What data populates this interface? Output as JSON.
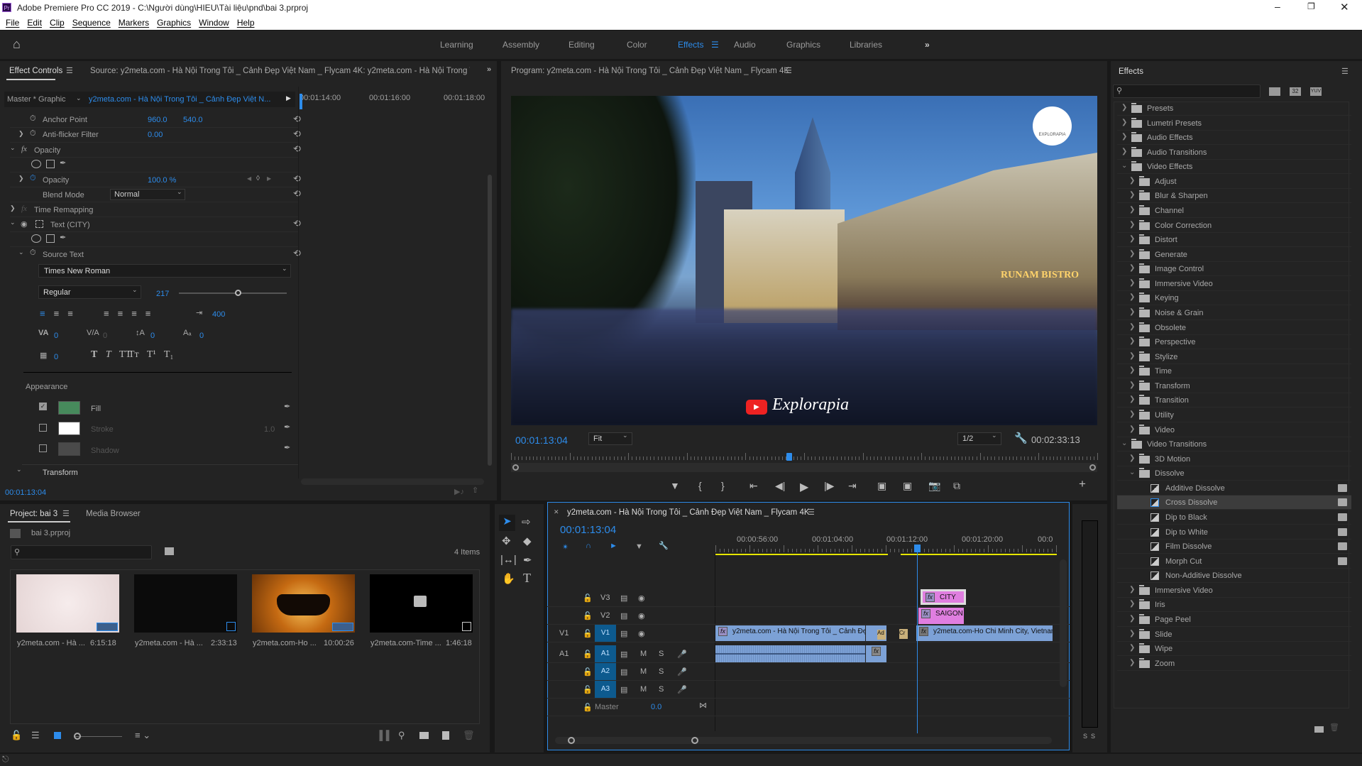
{
  "window": {
    "title": "Adobe Premiere Pro CC 2019 - C:\\Người dùng\\HIEU\\Tài liệu\\pnd\\bai 3.prproj",
    "app_icon": "Pr"
  },
  "menu": [
    "File",
    "Edit",
    "Clip",
    "Sequence",
    "Markers",
    "Graphics",
    "Window",
    "Help"
  ],
  "workspaces": {
    "items": [
      "Learning",
      "Assembly",
      "Editing",
      "Color",
      "Effects",
      "Audio",
      "Graphics",
      "Libraries"
    ],
    "active": "Effects"
  },
  "effect_controls": {
    "tab": "Effect Controls",
    "source_tab": "Source: y2meta.com - Hà Nội Trong Tôi _ Cảnh Đẹp Việt Nam _ Flycam 4K: y2meta.com - Hà Nội Trong Tôi _",
    "master": "Master * Graphic",
    "clip": "y2meta.com - Hà Nội Trong Tôi _ Cảnh Đẹp Việt N...",
    "ruler": [
      "00:01:14:00",
      "00:01:16:00",
      "00:01:18:00"
    ],
    "anchor_label": "Anchor Point",
    "anchor_x": "960.0",
    "anchor_y": "540.0",
    "antiflicker_label": "Anti-flicker Filter",
    "antiflicker": "0.00",
    "opacity_group": "Opacity",
    "opacity_label": "Opacity",
    "opacity": "100.0 %",
    "blend_label": "Blend Mode",
    "blend": "Normal",
    "time_remap": "Time Remapping",
    "text_layer": "Text (CITY)",
    "source_text": "Source Text",
    "font": "Times New Roman",
    "style": "Regular",
    "size": "217",
    "size_fraction": 0.55,
    "tab_width": "400",
    "kerning": "0",
    "tracking": "0",
    "leading": "0",
    "baseline": "0",
    "tsume": "0",
    "appearance": "Appearance",
    "fill_label": "Fill",
    "fill_color": "#478a5c",
    "fill_checked": true,
    "stroke_label": "Stroke",
    "stroke_color": "#ffffff",
    "stroke_width": "1.0",
    "stroke_checked": false,
    "shadow_label": "Shadow",
    "shadow_checked": false,
    "transform": "Transform",
    "timecode": "00:01:13:04"
  },
  "program": {
    "title": "Program: y2meta.com - Hà Nội Trong Tôi _ Cảnh Đẹp Việt Nam _ Flycam 4K",
    "timecode": "00:01:13:04",
    "zoom": "Fit",
    "resolution": "1/2",
    "duration": "00:02:33:13",
    "playhead_fraction": 0.475,
    "overlay_text": "Explorapia",
    "sign_text": "RUNAM BISTRO",
    "logo_text": "EXPLORAPIA"
  },
  "project": {
    "tab": "Project: bai 3",
    "media_browser": "Media Browser",
    "file": "bai 3.prproj",
    "count": "4 Items",
    "items": [
      {
        "name": "y2meta.com - Hà ...",
        "duration": "6:15:18"
      },
      {
        "name": "y2meta.com - Hà ...",
        "duration": "2:33:13"
      },
      {
        "name": "y2meta.com-Ho ...",
        "duration": "10:00:26"
      },
      {
        "name": "y2meta.com-Time ...",
        "duration": "1:46:18"
      }
    ]
  },
  "timeline": {
    "title": "y2meta.com - Hà Nội Trong Tôi _ Cảnh Đẹp Việt Nam _ Flycam 4K",
    "timecode": "00:01:13:04",
    "ruler": [
      "00:00:56:00",
      "00:01:04:00",
      "00:01:12:00",
      "00:01:20:00",
      "00:0"
    ],
    "tracks": {
      "v3": "V3",
      "v2": "V2",
      "v1": "V1",
      "a1": "A1",
      "a2": "A2",
      "a3": "A3",
      "master": "Master",
      "master_val": "0.0",
      "m": "M",
      "s": "S"
    },
    "clips": {
      "v1a": "y2meta.com - Hà Nội Trong Tôi _ Cảnh Đẹp",
      "v1b": "y2meta.com-Ho Chi Minh City, Vietnam",
      "city": "CITY",
      "saigon": "SAIGON",
      "fx": "fx",
      "ad": "Ad",
      "cr": "Cr"
    },
    "accent": "#2d8ceb",
    "clip_video": "#7ca1d6",
    "clip_graphic": "#e07ee0"
  },
  "meter": {
    "s1": "S",
    "s2": "S"
  },
  "effects": {
    "title": "Effects",
    "badges": [
      "accelerated",
      "32",
      "YUV"
    ],
    "tree": [
      {
        "label": "Presets",
        "level": 0,
        "type": "star"
      },
      {
        "label": "Lumetri Presets",
        "level": 0,
        "type": "star"
      },
      {
        "label": "Audio Effects",
        "level": 0,
        "type": "folder"
      },
      {
        "label": "Audio Transitions",
        "level": 0,
        "type": "folder"
      },
      {
        "label": "Video Effects",
        "level": 0,
        "type": "folder",
        "open": true
      },
      {
        "label": "Adjust",
        "level": 1,
        "type": "folder"
      },
      {
        "label": "Blur & Sharpen",
        "level": 1,
        "type": "folder"
      },
      {
        "label": "Channel",
        "level": 1,
        "type": "folder"
      },
      {
        "label": "Color Correction",
        "level": 1,
        "type": "folder"
      },
      {
        "label": "Distort",
        "level": 1,
        "type": "folder"
      },
      {
        "label": "Generate",
        "level": 1,
        "type": "folder"
      },
      {
        "label": "Image Control",
        "level": 1,
        "type": "folder"
      },
      {
        "label": "Immersive Video",
        "level": 1,
        "type": "folder"
      },
      {
        "label": "Keying",
        "level": 1,
        "type": "folder"
      },
      {
        "label": "Noise & Grain",
        "level": 1,
        "type": "folder"
      },
      {
        "label": "Obsolete",
        "level": 1,
        "type": "folder"
      },
      {
        "label": "Perspective",
        "level": 1,
        "type": "folder"
      },
      {
        "label": "Stylize",
        "level": 1,
        "type": "folder"
      },
      {
        "label": "Time",
        "level": 1,
        "type": "folder"
      },
      {
        "label": "Transform",
        "level": 1,
        "type": "folder"
      },
      {
        "label": "Transition",
        "level": 1,
        "type": "folder"
      },
      {
        "label": "Utility",
        "level": 1,
        "type": "folder"
      },
      {
        "label": "Video",
        "level": 1,
        "type": "folder"
      },
      {
        "label": "Video Transitions",
        "level": 0,
        "type": "folder",
        "open": true
      },
      {
        "label": "3D Motion",
        "level": 1,
        "type": "folder"
      },
      {
        "label": "Dissolve",
        "level": 1,
        "type": "folder",
        "open": true
      },
      {
        "label": "Additive Dissolve",
        "level": 2,
        "type": "transition",
        "badge": true
      },
      {
        "label": "Cross Dissolve",
        "level": 2,
        "type": "transition",
        "badge": true,
        "selected": true
      },
      {
        "label": "Dip to Black",
        "level": 2,
        "type": "transition",
        "badge": true
      },
      {
        "label": "Dip to White",
        "level": 2,
        "type": "transition",
        "badge": true
      },
      {
        "label": "Film Dissolve",
        "level": 2,
        "type": "transition",
        "badge": true
      },
      {
        "label": "Morph Cut",
        "level": 2,
        "type": "transition",
        "badge": true
      },
      {
        "label": "Non-Additive Dissolve",
        "level": 2,
        "type": "transition"
      },
      {
        "label": "Immersive Video",
        "level": 1,
        "type": "folder"
      },
      {
        "label": "Iris",
        "level": 1,
        "type": "folder"
      },
      {
        "label": "Page Peel",
        "level": 1,
        "type": "folder"
      },
      {
        "label": "Slide",
        "level": 1,
        "type": "folder"
      },
      {
        "label": "Wipe",
        "level": 1,
        "type": "folder"
      },
      {
        "label": "Zoom",
        "level": 1,
        "type": "folder"
      }
    ]
  }
}
